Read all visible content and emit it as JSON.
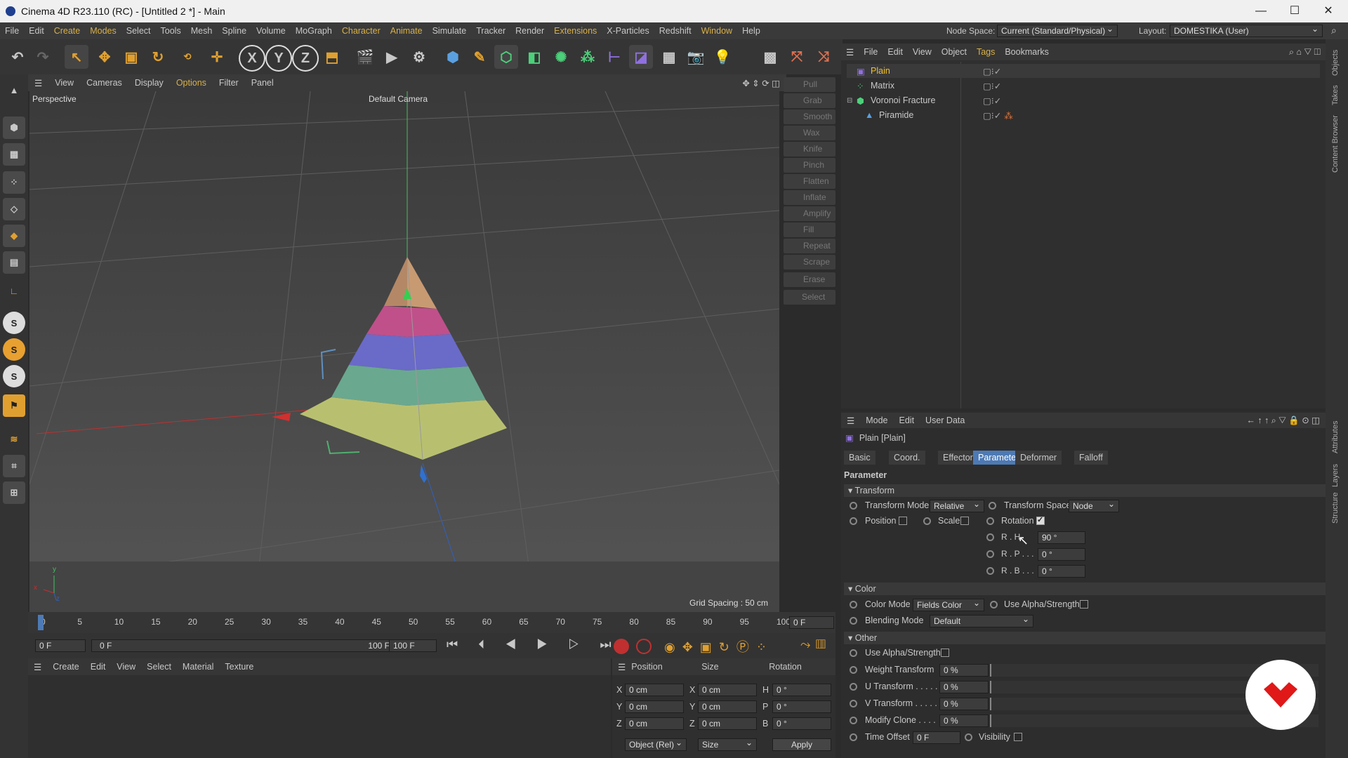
{
  "window": {
    "title": "Cinema 4D R23.110 (RC) - [Untitled 2 *] - Main"
  },
  "menus": [
    "File",
    "Edit",
    "Create",
    "Modes",
    "Select",
    "Tools",
    "Mesh",
    "Spline",
    "Volume",
    "MoGraph",
    "Character",
    "Animate",
    "Simulate",
    "Tracker",
    "Render",
    "Extensions",
    "X-Particles",
    "Redshift",
    "Window",
    "Help"
  ],
  "nodespace": {
    "label": "Node Space:",
    "value": "Current (Standard/Physical)"
  },
  "layout": {
    "label": "Layout:",
    "value": "DOMESTIKA (User)"
  },
  "toolbar": {
    "x": "X",
    "y": "Y",
    "z": "Z"
  },
  "viewport": {
    "menu": [
      "View",
      "Cameras",
      "Display",
      "Options",
      "Filter",
      "Panel"
    ],
    "label": "Perspective",
    "camera": "Default Camera",
    "grid_spacing": "Grid Spacing : 50 cm",
    "axis_y": "y",
    "axis_x": "x",
    "axis_z": "z"
  },
  "sculpt": [
    "Pull",
    "Grab",
    "Smooth",
    "Wax",
    "Knife",
    "Pinch",
    "Flatten",
    "Inflate",
    "Amplify",
    "Fill",
    "Repeat",
    "Scrape",
    "Erase",
    "Select"
  ],
  "objects": {
    "menu": [
      "File",
      "Edit",
      "View",
      "Object",
      "Tags",
      "Bookmarks"
    ],
    "items": [
      "Plain",
      "Matrix",
      "Voronoi Fracture",
      "Piramide"
    ]
  },
  "attributes": {
    "menu": [
      "Mode",
      "Edit",
      "User Data"
    ],
    "title": "Plain [Plain]",
    "tabs": [
      "Basic",
      "Coord.",
      "Effector",
      "Parameter",
      "Deformer",
      "Falloff"
    ],
    "section_title": "Parameter",
    "transform": {
      "header": "Transform",
      "mode_label": "Transform Mode",
      "mode_value": "Relative",
      "space_label": "Transform Space",
      "space_value": "Node",
      "position": "Position",
      "scale": "Scale",
      "rotation": "Rotation",
      "rh_label": "R . H",
      "rh_value": "90 °",
      "rp_label": "R . P . . .",
      "rp_value": "0 °",
      "rb_label": "R . B . . .",
      "rb_value": "0 °"
    },
    "color": {
      "header": "Color",
      "mode_label": "Color Mode",
      "mode_value": "Fields Color",
      "alpha_label": "Use Alpha/Strength",
      "blend_label": "Blending Mode",
      "blend_value": "Default"
    },
    "other": {
      "header": "Other",
      "alpha_label": "Use Alpha/Strength",
      "weight_label": "Weight Transform",
      "weight_value": "0 %",
      "u_label": "U Transform . . . . .",
      "u_value": "0 %",
      "v_label": "V Transform . . . . .",
      "v_value": "0 %",
      "clone_label": "Modify Clone . . . .",
      "clone_value": "0 %",
      "time_label": "Time Offset",
      "time_value": "0 F",
      "vis_label": "Visibility"
    }
  },
  "timeline": {
    "ticks": [
      "0",
      "5",
      "10",
      "15",
      "20",
      "25",
      "30",
      "35",
      "40",
      "45",
      "50",
      "55",
      "60",
      "65",
      "70",
      "75",
      "80",
      "85",
      "90",
      "95",
      "100"
    ],
    "current": "0 F",
    "start": "0 F",
    "range_start": "0 F",
    "range_end": "100 F",
    "end": "100 F"
  },
  "materials": {
    "menu": [
      "Create",
      "Edit",
      "View",
      "Select",
      "Material",
      "Texture"
    ]
  },
  "coords": {
    "headers": [
      "Position",
      "Size",
      "Rotation"
    ],
    "px": "0 cm",
    "py": "0 cm",
    "pz": "0 cm",
    "sx": "0 cm",
    "sy": "0 cm",
    "sz": "0 cm",
    "rh": "0 °",
    "rp": "0 °",
    "rb": "0 °",
    "lx": "X",
    "ly": "Y",
    "lz": "Z",
    "lh": "H",
    "lp": "P",
    "lb": "B",
    "mode": "Object (Rel)",
    "size_mode": "Size",
    "apply": "Apply"
  },
  "sidetabs": [
    "Objects",
    "Takes",
    "Content Browser",
    "Attributes",
    "Layers",
    "Structure"
  ]
}
